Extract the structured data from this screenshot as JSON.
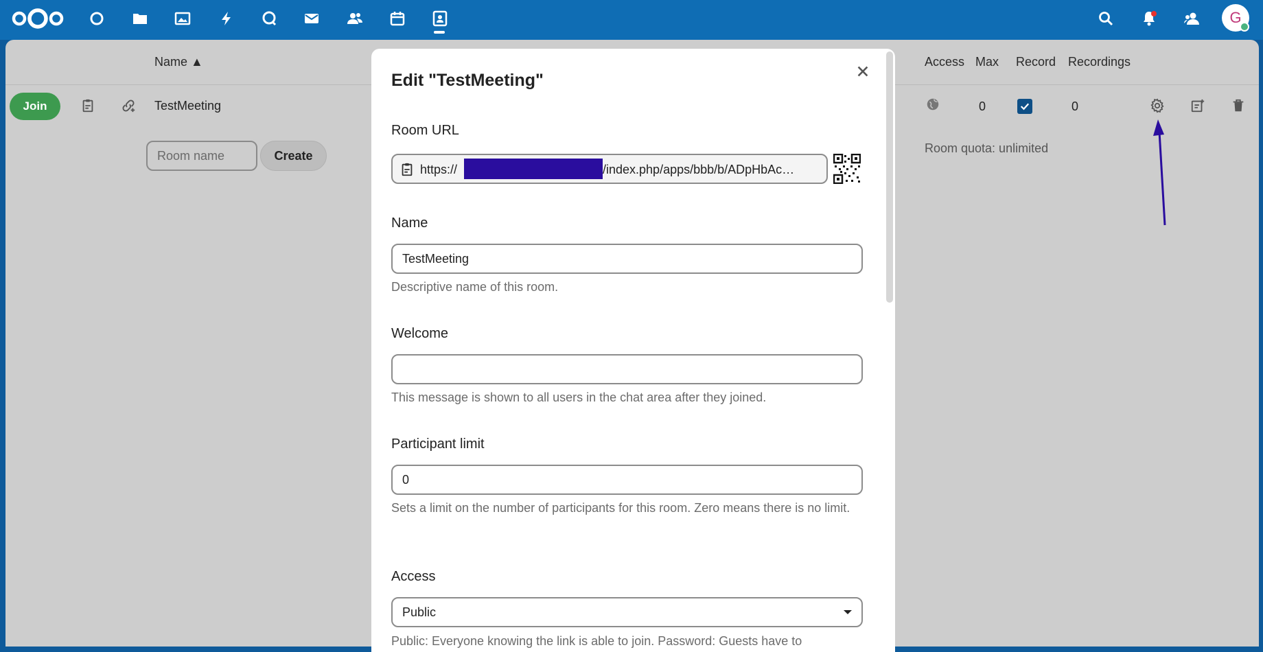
{
  "header": {
    "app_icons": [
      "dashboard-icon",
      "files-icon",
      "photos-icon",
      "activity-icon",
      "talk-icon",
      "mail-icon",
      "contacts-icon",
      "calendar-icon",
      "bbb-icon"
    ],
    "right_icons": [
      "search-icon",
      "notifications-icon",
      "contacts-menu-icon"
    ],
    "avatar_initial": "G",
    "accent_color": "#0f6db4"
  },
  "table": {
    "columns": {
      "name": "Name ▲",
      "access": "Access",
      "max": "Max",
      "record": "Record",
      "recordings": "Recordings"
    },
    "rows": [
      {
        "join_label": "Join",
        "name": "TestMeeting",
        "max": "0",
        "recordings": "0",
        "record_checked": true
      }
    ],
    "new_room": {
      "placeholder": "Room name",
      "create_label": "Create"
    },
    "quota": "Room quota: unlimited"
  },
  "modal": {
    "title": "Edit \"TestMeeting\"",
    "room_url": {
      "label": "Room URL",
      "prefix": "https://",
      "suffix": "/index.php/apps/bbb/b/ADpHbAc…"
    },
    "name": {
      "label": "Name",
      "value": "TestMeeting",
      "hint": "Descriptive name of this room."
    },
    "welcome": {
      "label": "Welcome",
      "value": "",
      "hint": "This message is shown to all users in the chat area after they joined."
    },
    "participant_limit": {
      "label": "Participant limit",
      "value": "0",
      "hint": "Sets a limit on the number of participants for this room. Zero means there is no limit."
    },
    "access": {
      "label": "Access",
      "value": "Public",
      "hint": "Public: Everyone knowing the link is able to join. Password: Guests have to"
    }
  }
}
